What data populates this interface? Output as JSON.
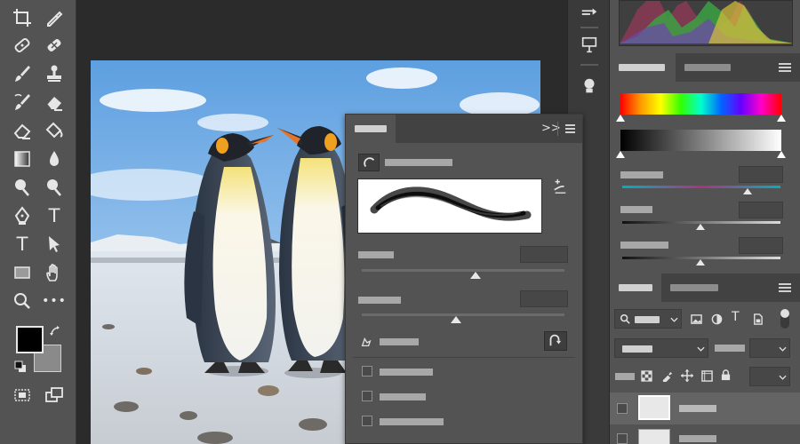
{
  "app": {
    "name": "image-editor"
  },
  "colors": {
    "toolbar_bg": "#535353",
    "canvas_bg": "#2b2b2b",
    "panel_bg": "#535353",
    "panel_tab_bg": "#424242",
    "foreground_swatch": "#000000",
    "background_swatch": "#8a8a8a"
  },
  "toolbar": {
    "tools": [
      {
        "name": "crop-icon",
        "glyph": ""
      },
      {
        "name": "eyedropper-icon",
        "glyph": ""
      },
      {
        "name": "healing-brush-icon",
        "glyph": ""
      },
      {
        "name": "patch-icon",
        "glyph": ""
      },
      {
        "name": "brush-icon",
        "glyph": ""
      },
      {
        "name": "clone-stamp-icon",
        "glyph": ""
      },
      {
        "name": "history-brush-icon",
        "glyph": ""
      },
      {
        "name": "eraser-icon",
        "glyph": ""
      },
      {
        "name": "eraser-alt-icon",
        "glyph": ""
      },
      {
        "name": "paint-bucket-icon",
        "glyph": ""
      },
      {
        "name": "gradient-icon",
        "glyph": ""
      },
      {
        "name": "blur-icon",
        "glyph": ""
      },
      {
        "name": "dodge-icon",
        "glyph": ""
      },
      {
        "name": "zoom-tool-icon",
        "glyph": ""
      },
      {
        "name": "pen-icon",
        "glyph": ""
      },
      {
        "name": "type-icon",
        "glyph": "T"
      },
      {
        "name": "type-vertical-icon",
        "glyph": "T"
      },
      {
        "name": "path-select-icon",
        "glyph": ""
      },
      {
        "name": "rectangle-icon",
        "glyph": ""
      },
      {
        "name": "hand-icon",
        "glyph": ""
      },
      {
        "name": "zoom-icon",
        "glyph": ""
      },
      {
        "name": "more-tools-icon",
        "glyph": "•••"
      }
    ]
  },
  "brush_panel": {
    "header_controls": ">>"
  },
  "layers": {
    "filter_icons": [
      "image-filter-icon",
      "adjustment-filter-icon",
      "type-filter-icon",
      "shape-filter-icon",
      "smart-object-filter-icon"
    ]
  }
}
